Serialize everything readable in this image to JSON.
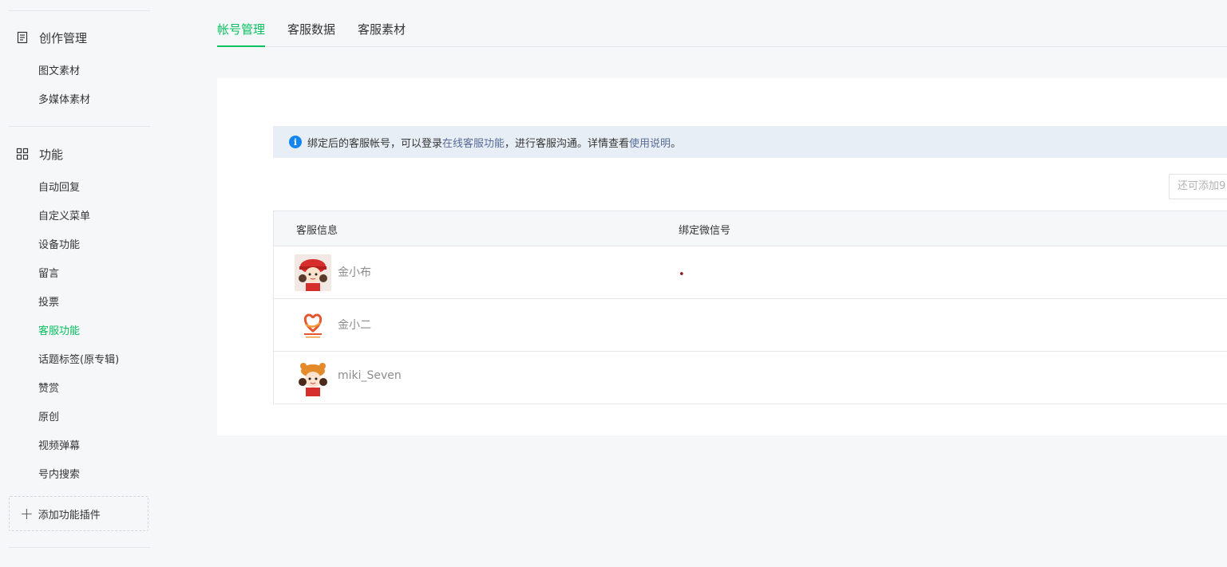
{
  "sidebar": {
    "sections": [
      {
        "title": "创作管理",
        "items": [
          "图文素材",
          "多媒体素材"
        ]
      },
      {
        "title": "功能",
        "items": [
          "自动回复",
          "自定义菜单",
          "设备功能",
          "留言",
          "投票",
          "客服功能",
          "话题标签(原专辑)",
          "赞赏",
          "原创",
          "视频弹幕",
          "号内搜索"
        ]
      }
    ],
    "active_item": "客服功能",
    "add_plugin_label": "添加功能插件"
  },
  "tabs": [
    {
      "label": "帐号管理",
      "active": true
    },
    {
      "label": "客服数据",
      "active": false
    },
    {
      "label": "客服素材",
      "active": false
    }
  ],
  "notice": {
    "text_before": "绑定后的客服帐号，可以登录",
    "link1": "在线客服功能",
    "text_middle": "，进行客服沟通。详情查看",
    "link2": "使用说明",
    "text_after": "。"
  },
  "add_input_text": "还可添加9",
  "table": {
    "columns": [
      "客服信息",
      "绑定微信号"
    ],
    "rows": [
      {
        "name": "金小布",
        "avatar": "avatar-girl-red-hat"
      },
      {
        "name": "金小二",
        "avatar": "avatar-heart-logo"
      },
      {
        "name": "miki_Seven",
        "avatar": "avatar-girl-tiger-hat"
      }
    ]
  },
  "colors": {
    "accent": "#07c160",
    "link": "#576b95",
    "info": "#1485ee"
  }
}
